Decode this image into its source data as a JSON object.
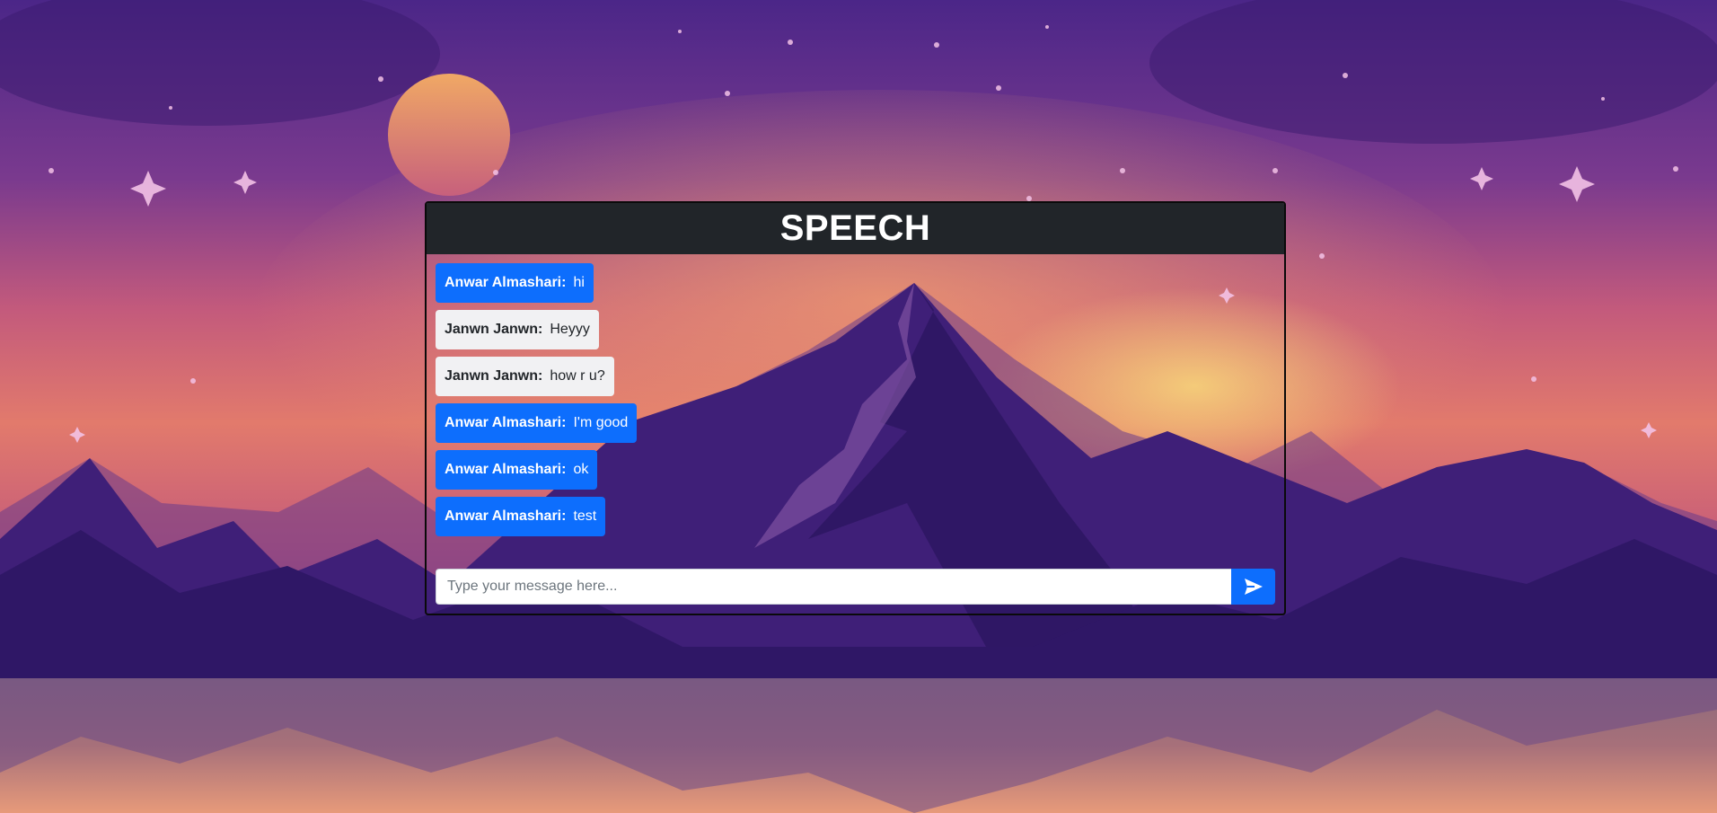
{
  "app": {
    "title": "SPEECH"
  },
  "messages": [
    {
      "sender": "Anwar Almashari:",
      "text": "hi",
      "is_self": true
    },
    {
      "sender": "Janwn Janwn:",
      "text": "Heyyy",
      "is_self": false
    },
    {
      "sender": "Janwn Janwn:",
      "text": "how r u?",
      "is_self": false
    },
    {
      "sender": "Anwar Almashari:",
      "text": "I'm good",
      "is_self": true
    },
    {
      "sender": "Anwar Almashari:",
      "text": "ok",
      "is_self": true
    },
    {
      "sender": "Anwar Almashari:",
      "text": "test",
      "is_self": true
    }
  ],
  "composer": {
    "placeholder": "Type your message here...",
    "value": "",
    "send_icon": "send-icon"
  },
  "colors": {
    "header_bg": "#212529",
    "self_bubble": "#0d6efd",
    "other_bubble": "#f1f1f3",
    "send_button": "#0d6efd"
  }
}
